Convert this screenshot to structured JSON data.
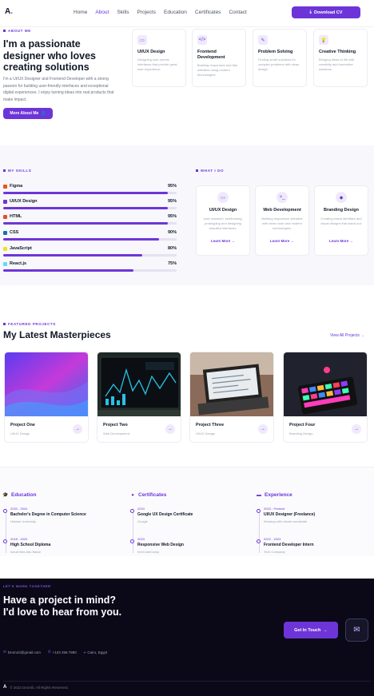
{
  "nav": {
    "logo_text": "A",
    "logo_dot": ".",
    "links": [
      "Home",
      "About",
      "Skills",
      "Projects",
      "Education",
      "Certificates",
      "Contact"
    ],
    "download_label": "Download CV"
  },
  "about": {
    "eyebrow": "About Me",
    "title": "I'm a passionate designer who loves creating solutions",
    "description": "I'm a UI/UX Designer and Frontend Developer with a strong passion for building user-friendly interfaces and exceptional digital experiences. I enjoy turning ideas into real products that make impact.",
    "button_label": "More About Me",
    "cards": [
      {
        "title": "UI/UX Design",
        "desc": "Designing user-centric interfaces that provide great user experience.",
        "icon": "monitor-icon"
      },
      {
        "title": "Frontend Development",
        "desc": "Building responsive and fast websites using modern technologies.",
        "icon": "code-icon"
      },
      {
        "title": "Problem Solving",
        "desc": "Finding smart solutions for complex problems with clean design.",
        "icon": "pen-icon"
      },
      {
        "title": "Creative Thinking",
        "desc": "Bringing ideas to life with creativity and innovative solutions.",
        "icon": "bulb-icon"
      }
    ]
  },
  "skills": {
    "eyebrow": "My Skills",
    "items": [
      {
        "name": "Figma",
        "percent": "95%",
        "level": 0.95,
        "color": "#f24e1e"
      },
      {
        "name": "UI/UX Design",
        "percent": "95%",
        "level": 0.95,
        "color": "#6d35d8"
      },
      {
        "name": "HTML",
        "percent": "95%",
        "level": 0.95,
        "color": "#e34f26"
      },
      {
        "name": "CSS",
        "percent": "90%",
        "level": 0.9,
        "color": "#1572b6"
      },
      {
        "name": "JavaScript",
        "percent": "80%",
        "level": 0.8,
        "color": "#f7df1e"
      },
      {
        "name": "React.js",
        "percent": "75%",
        "level": 0.75,
        "color": "#61dafb"
      }
    ]
  },
  "whatido": {
    "eyebrow": "What I Do",
    "cards": [
      {
        "title": "UI/UX Design",
        "desc": "User research, wireframing, prototyping and designing beautiful interfaces.",
        "link": "Learn More"
      },
      {
        "title": "Web Development",
        "desc": "Building responsive websites with clean code and modern technologies.",
        "link": "Learn More"
      },
      {
        "title": "Branding Design",
        "desc": "Creating brand identities and visual designs that stand out.",
        "link": "Learn More"
      }
    ]
  },
  "projects": {
    "eyebrow": "Featured Projects",
    "title": "My Latest Masterpieces",
    "view_all": "View All Projects",
    "items": [
      {
        "title": "Project One",
        "category": "UI/UX Design"
      },
      {
        "title": "Project Two",
        "category": "Web Development"
      },
      {
        "title": "Project Three",
        "category": "UI/UX Design"
      },
      {
        "title": "Project Four",
        "category": "Branding Design"
      }
    ]
  },
  "education": {
    "heading": "Education",
    "items": [
      {
        "years": "2020 - 2024",
        "title": "Bachelor's Degree in Computer Science",
        "sub": "Helwan University"
      },
      {
        "years": "2018 - 2020",
        "title": "High School Diploma",
        "sub": "Ismail Bek Abu Bakar"
      }
    ]
  },
  "certificates": {
    "heading": "Certificates",
    "items": [
      {
        "years": "2024",
        "title": "Google UX Design Certificate",
        "sub": "Google"
      },
      {
        "years": "2023",
        "title": "Responsive Web Design",
        "sub": "freeCodeCamp"
      }
    ]
  },
  "experience": {
    "heading": "Experience",
    "items": [
      {
        "years": "2023 - Present",
        "title": "UI/UX Designer (Freelance)",
        "sub": "Working with clients worldwide"
      },
      {
        "years": "2022 - 2023",
        "title": "Frontend Developer Intern",
        "sub": "Tech Company"
      }
    ]
  },
  "footer": {
    "eyebrow": "Let's Work Together",
    "title_line1": "Have a project in mind?",
    "title_line2": "I'd love to hear from you.",
    "email": "Drom43@gmail.com",
    "phone": "+123 456 7890",
    "location": "Cairo, Egypt",
    "cta_label": "Get In Touch",
    "logo_text": "A",
    "copyright": "© 2024 Dromib. All Rights Reserved."
  }
}
